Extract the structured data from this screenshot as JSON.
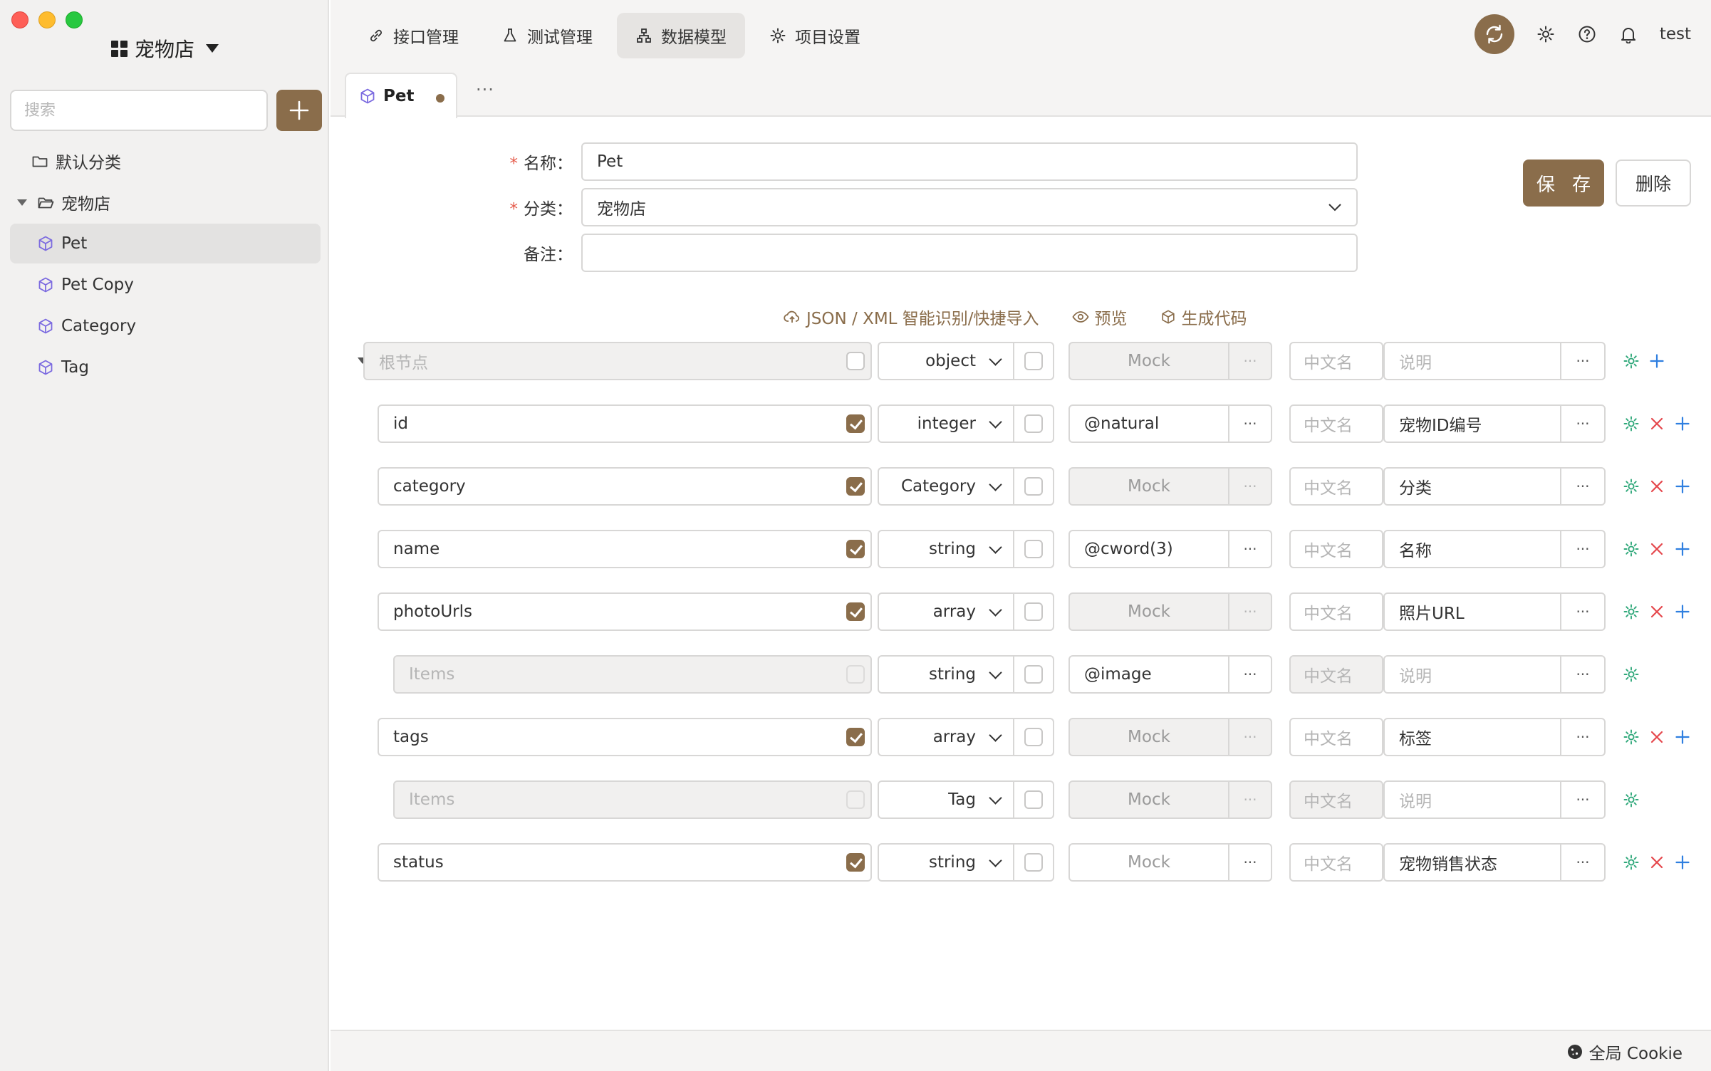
{
  "window": {
    "project_name": "宠物店"
  },
  "sidebar": {
    "search": {
      "placeholder": "搜索"
    },
    "add_icon": "plus-icon",
    "tree": [
      {
        "label": "默认分类",
        "icon": "folder-icon",
        "level": 0,
        "selected": false
      },
      {
        "label": "宠物店",
        "icon": "folder-open-icon",
        "level": 0,
        "expanded": true,
        "selected": false
      },
      {
        "label": "Pet",
        "icon": "cube-icon",
        "level": 1,
        "selected": true
      },
      {
        "label": "Pet Copy",
        "icon": "cube-icon",
        "level": 1,
        "selected": false
      },
      {
        "label": "Category",
        "icon": "cube-icon",
        "level": 1,
        "selected": false
      },
      {
        "label": "Tag",
        "icon": "cube-icon",
        "level": 1,
        "selected": false
      }
    ]
  },
  "topnav": {
    "tabs": [
      {
        "label": "接口管理",
        "icon": "link-icon",
        "active": false
      },
      {
        "label": "测试管理",
        "icon": "flask-icon",
        "active": false
      },
      {
        "label": "数据模型",
        "icon": "hierarchy-icon",
        "active": true
      },
      {
        "label": "项目设置",
        "icon": "gear-icon",
        "active": false
      }
    ],
    "right_icons": [
      "sync-icon",
      "gear-icon",
      "help-icon",
      "bell-icon"
    ],
    "user": "test"
  },
  "doc_tabs": {
    "active": {
      "label": "Pet",
      "icon": "cube-icon",
      "unsaved": true
    },
    "more": "···"
  },
  "form": {
    "name_label": "名称",
    "name_value": "Pet",
    "category_label": "分类",
    "category_value": "宠物店",
    "note_label": "备注",
    "note_value": "",
    "save_label": "保 存",
    "delete_label": "删除"
  },
  "tools": {
    "import_label": "JSON / XML 智能识别/快捷导入",
    "preview_label": "预览",
    "codegen_label": "生成代码"
  },
  "schema": {
    "placeholders": {
      "mock": "Mock",
      "cn_name": "中文名",
      "desc": "说明",
      "more": "···"
    },
    "rows": [
      {
        "name": "根节点",
        "name_placeholder": true,
        "level": 0,
        "required": "none",
        "type": "object",
        "mock": "",
        "cn_disabled": false,
        "desc": "",
        "actions": [
          "gear",
          "add"
        ]
      },
      {
        "name": "id",
        "level": 1,
        "required": "checked",
        "type": "integer",
        "mock": "@natural",
        "desc": "宠物ID编号",
        "actions": [
          "gear",
          "remove",
          "add"
        ]
      },
      {
        "name": "category",
        "level": 1,
        "required": "checked",
        "type": "Category",
        "mock": "",
        "desc": "分类",
        "actions": [
          "gear",
          "remove",
          "add"
        ]
      },
      {
        "name": "name",
        "level": 1,
        "required": "checked",
        "type": "string",
        "mock": "@cword(3)",
        "desc": "名称",
        "actions": [
          "gear",
          "remove",
          "add"
        ]
      },
      {
        "name": "photoUrls",
        "level": 1,
        "required": "checked",
        "type": "array",
        "mock": "",
        "desc": "照片URL",
        "actions": [
          "gear",
          "remove",
          "add"
        ]
      },
      {
        "name": "Items",
        "name_placeholder": true,
        "level": 2,
        "required": "disabled",
        "type": "string",
        "mock": "@image",
        "cn_disabled": true,
        "desc": "",
        "actions": [
          "gear"
        ]
      },
      {
        "name": "tags",
        "level": 1,
        "required": "checked",
        "type": "array",
        "mock": "",
        "desc": "标签",
        "actions": [
          "gear",
          "remove",
          "add"
        ]
      },
      {
        "name": "Items",
        "name_placeholder": true,
        "level": 2,
        "required": "disabled",
        "type": "Tag",
        "mock": "",
        "cn_disabled": true,
        "desc": "",
        "actions": [
          "gear"
        ]
      },
      {
        "name": "status",
        "level": 1,
        "required": "checked",
        "type": "string",
        "mock": "",
        "mock_white": true,
        "desc": "宠物销售状态",
        "actions": [
          "gear",
          "remove",
          "add"
        ]
      }
    ]
  },
  "footer": {
    "cookie_label": "全局 Cookie"
  },
  "colors": {
    "accent": "#8a6d4b",
    "gear": "#2fa87a",
    "remove": "#e5484d",
    "add": "#2f7fe0",
    "cube": "#7c6be0"
  }
}
